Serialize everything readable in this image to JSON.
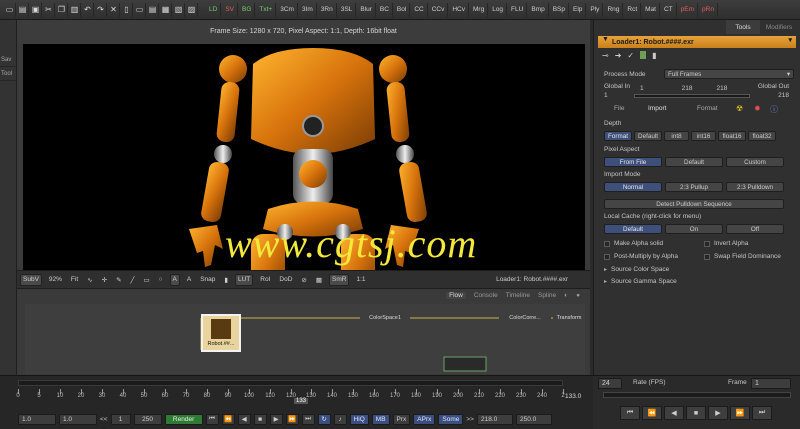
{
  "toolbar": {
    "items": [
      "LD",
      "SV",
      "BG",
      "Txt+",
      "3Cm",
      "3Im",
      "3Rn",
      "3SL",
      "Blur",
      "BC",
      "Bol",
      "CC",
      "CCv",
      "HCv",
      "Mrg",
      "Log",
      "FLU",
      "Bmp",
      "BSp",
      "Elp",
      "Ply",
      "Rng",
      "Rct",
      "Mat",
      "CT",
      "pEm",
      "pRn"
    ]
  },
  "left_strip": {
    "items": [
      "Sav",
      "Tool"
    ]
  },
  "viewer": {
    "header": "Frame Size: 1280 x 720, Pixel Aspect: 1:1, Depth: 16bit float",
    "watermark": "www.cgtsj.com",
    "bar": {
      "subv": "SubV",
      "zoom": "92%",
      "fit": "Fit",
      "snap": "Snap",
      "lut": "LUT",
      "roi": "RoI",
      "dod": "DoD",
      "smr": "SmR",
      "ratio": "1:1",
      "node": "Loader1: Robot.####.exr"
    }
  },
  "tools_panel": {
    "tabs": [
      "Tools",
      "Modifiers"
    ],
    "tool_name": "Loader1: Robot.####.exr",
    "process_mode_label": "Process Mode",
    "process_mode_value": "Full Frames",
    "global_in_label": "Global In",
    "global_in_value": "1",
    "global_in_mid": "1",
    "global_mid_a": "218",
    "global_mid_b": "218",
    "global_out_label": "Global Out",
    "global_out_value": "218",
    "subtabs": [
      "File",
      "Import",
      "Format"
    ],
    "depth_label": "Depth",
    "depth_options": [
      "Format",
      "Default",
      "int8",
      "int16",
      "float16",
      "float32"
    ],
    "pixel_aspect_label": "Pixel Aspect",
    "pixel_aspect_options": [
      "From File",
      "Default",
      "Custom"
    ],
    "import_mode_label": "Import Mode",
    "import_mode_options": [
      "Normal",
      "2:3 Pullup",
      "2:3 Pulldown"
    ],
    "detect_button": "Detect Pulldown Sequence",
    "local_cache_label": "Local Cache (right-click for menu)",
    "local_cache_options": [
      "Default",
      "On",
      "Off"
    ],
    "checkboxes": [
      "Make Alpha solid",
      "Invert Alpha",
      "Post-Multiply by Alpha",
      "Swap Field Dominance"
    ],
    "expanders": [
      "Source Color Space",
      "Source Gamma Space"
    ]
  },
  "flow": {
    "tabs": [
      "Flow",
      "Console",
      "Timeline",
      "Spline"
    ],
    "nodes": [
      "Robot.##...",
      "ColorSpace1",
      "ColorCorre...",
      "Transform"
    ]
  },
  "timeline": {
    "ticks": [
      "0",
      "5",
      "10",
      "20",
      "30",
      "40",
      "50",
      "60",
      "70",
      "80",
      "90",
      "100",
      "110",
      "120",
      "130",
      "140",
      "150",
      "160",
      "170",
      "180",
      "190",
      "200",
      "210",
      "220",
      "230",
      "240",
      "2"
    ],
    "current_marker": "133",
    "current_value": "133.0",
    "start_a": "1.0",
    "start_b": "1.0",
    "range_lt": "<<",
    "range_start": "1",
    "range_end": "250",
    "render": "Render",
    "hiq": "HiQ",
    "mb": "MB",
    "prx": "Prx",
    "aprx": "APrx",
    "some": "Some",
    "range_gt": ">>",
    "end_a": "218.0",
    "end_b": "250.0"
  },
  "transport": {
    "fps_value": "24",
    "fps_label": "Rate (FPS)",
    "frame_label": "Frame",
    "frame_value": "1"
  }
}
